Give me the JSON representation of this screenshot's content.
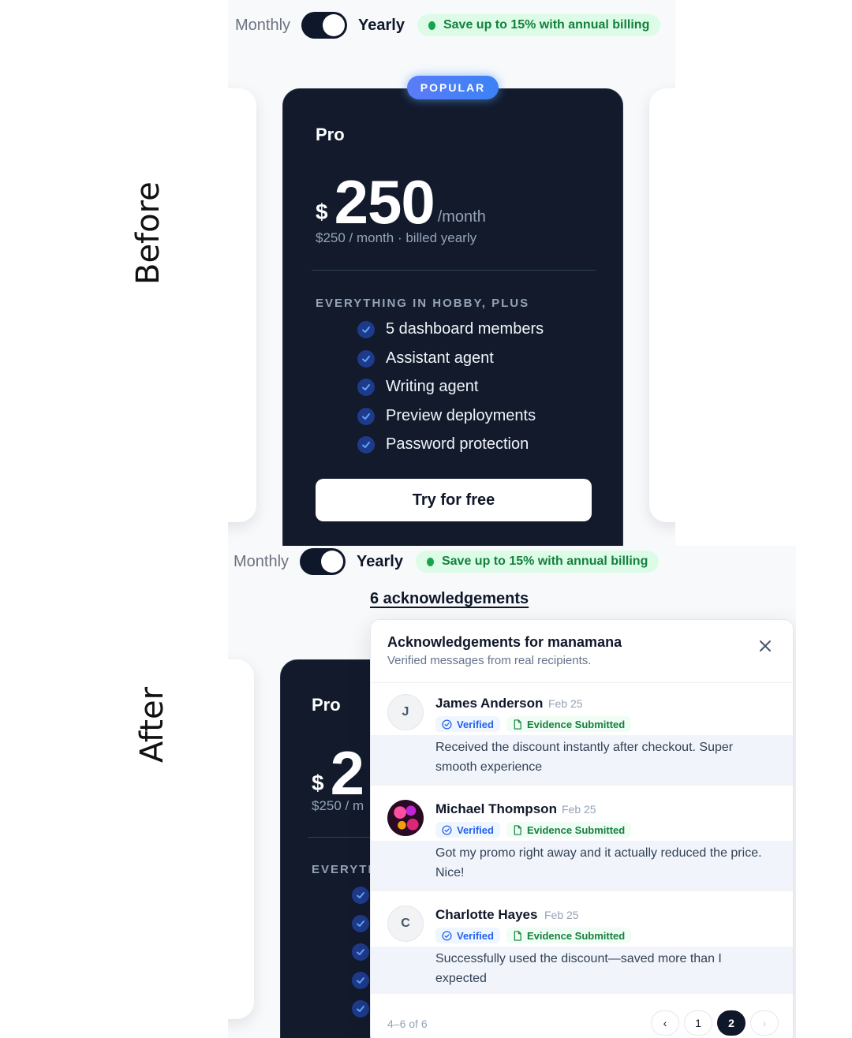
{
  "labels": {
    "before": "Before",
    "after": "After"
  },
  "billing": {
    "monthly": "Monthly",
    "yearly": "Yearly",
    "save_text": "Save up to 15% with annual billing",
    "selected": "yearly"
  },
  "plan": {
    "badge": "POPULAR",
    "name": "Pro",
    "currency": "$",
    "amount": "250",
    "per": "/month",
    "billed_note": "$250 / month · billed yearly",
    "features_heading": "EVERYTHING IN HOBBY, PLUS",
    "features": [
      "5 dashboard members",
      "Assistant agent",
      "Writing agent",
      "Preview deployments",
      "Password protection"
    ],
    "cta": "Try for free"
  },
  "after_plan_partial": {
    "amount_visible": "2",
    "billed_note_visible": "$250 / m",
    "features_heading_visible": "EVERYTH"
  },
  "acknowledgements": {
    "link_text": "6 acknowledgements",
    "title": "Acknowledgements for manamana",
    "subtitle": "Verified messages from real recipients.",
    "items": [
      {
        "initial": "J",
        "name": "James Anderson",
        "date": "Feb 25",
        "verified": "Verified",
        "evidence": "Evidence Submitted",
        "message": "Received the discount instantly after checkout. Super smooth experience"
      },
      {
        "initial": "",
        "name": "Michael Thompson",
        "date": "Feb 25",
        "verified": "Verified",
        "evidence": "Evidence Submitted",
        "message": "Got my promo right away and it actually reduced the price. Nice!"
      },
      {
        "initial": "C",
        "name": "Charlotte Hayes",
        "date": "Feb 25",
        "verified": "Verified",
        "evidence": "Evidence Submitted",
        "message": "Successfully used the discount—saved more than I expected"
      }
    ],
    "range": "4–6 of 6",
    "pages": [
      "1",
      "2"
    ],
    "current_page": "2",
    "prev_icon": "‹",
    "next_icon": "›"
  },
  "colors": {
    "card_dark": "#121a2c",
    "accent_blue": "#3b82f6",
    "save_green": "#15803d"
  }
}
